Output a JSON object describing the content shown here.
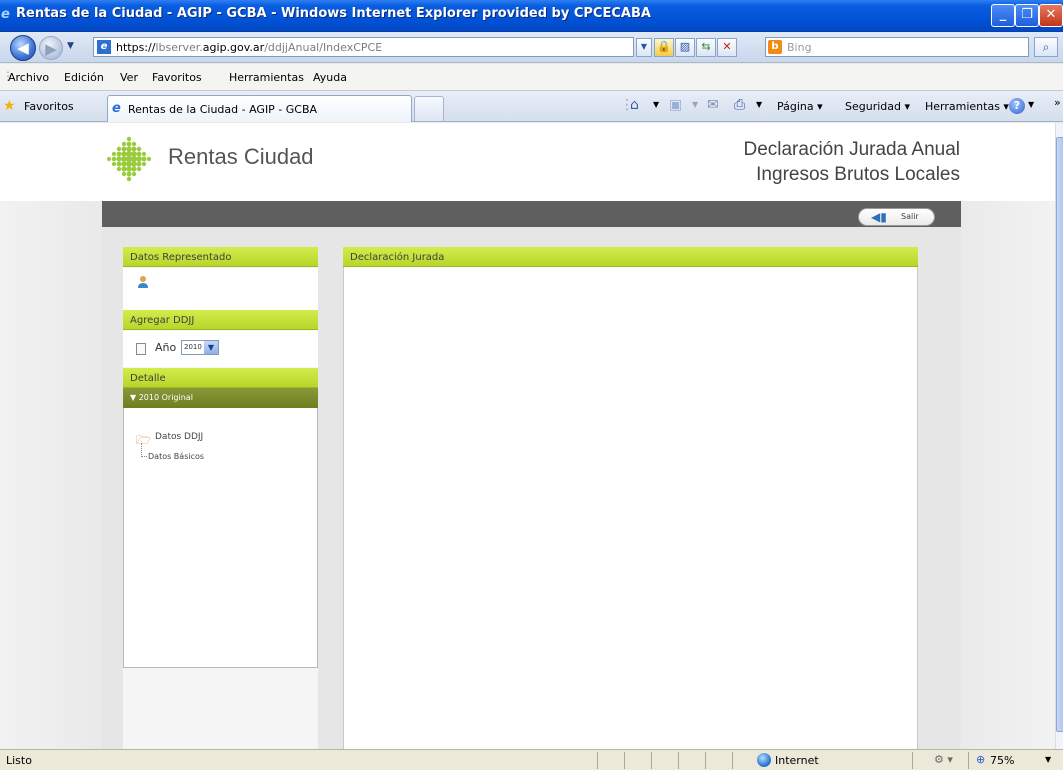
{
  "window": {
    "title": "Rentas de la Ciudad - AGIP - GCBA - Windows Internet Explorer provided by CPCECABA"
  },
  "address": {
    "url_prefix": "https://",
    "url_host_pre": "lbserver.",
    "url_host_main": "agip.gov.ar",
    "url_path": "/ddjjAnual/IndexCPCE"
  },
  "search": {
    "placeholder": "Bing",
    "provider": "Bing"
  },
  "menu": {
    "items": [
      "Archivo",
      "Edición",
      "Ver",
      "Favoritos",
      "Herramientas",
      "Ayuda"
    ]
  },
  "favbar": {
    "favorites_label": "Favoritos",
    "tab_title": "Rentas de la Ciudad - AGIP - GCBA",
    "commands": {
      "page": "Página",
      "security": "Seguridad",
      "tools": "Herramientas"
    }
  },
  "page": {
    "logo_text": "Rentas Ciudad",
    "header_line1": "Declaración Jurada Anual",
    "header_line2": "Ingresos Brutos Locales",
    "logout_label": "Salir",
    "left_panels": {
      "representado_title": "Datos Representado",
      "agregar_title": "Agregar DDJJ",
      "anio_label": "Año",
      "anio_value": "2010",
      "detalle_title": "Detalle",
      "detalle_sub": "2010 Original",
      "tree_folder": "Datos DDJJ",
      "tree_child": "Datos Básicos"
    },
    "main_panel_title": "Declaración Jurada"
  },
  "status": {
    "text": "Listo",
    "zone": "Internet",
    "zoom": "75%"
  },
  "colors": {
    "accent_green": "#c4e03a",
    "detalle_dark_green": "#7b8b2c",
    "dark_bar": "#5f5f5f"
  }
}
